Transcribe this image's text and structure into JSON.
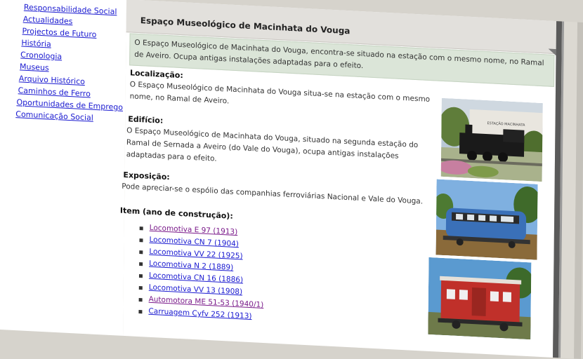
{
  "nav": {
    "items": [
      {
        "label": "Responsabilidade Social"
      },
      {
        "label": "Actualidades"
      },
      {
        "label": "Projectos de Futuro"
      },
      {
        "label": "História"
      },
      {
        "label": "Cronologia"
      },
      {
        "label": "Museus"
      },
      {
        "label": "Arquivo Histórico"
      },
      {
        "label": "Caminhos de Ferro"
      },
      {
        "label": "Oportunidades de Emprego"
      },
      {
        "label": "Comunicação Social"
      }
    ]
  },
  "page": {
    "title": "Espaço Museológico de Macinhata do Vouga",
    "intro": "O Espaço Museológico de Macinhata do Vouga, encontra-se situado na estação com o mesmo nome, no Ramal de Aveiro. Ocupa antigas instalações adaptadas para o efeito."
  },
  "sections": {
    "localizacao": {
      "heading": "Localização:",
      "text": "O Espaço Museológico de Macinhata do Vouga situa-se na estação com o mesmo nome, no Ramal de Aveiro."
    },
    "edificio": {
      "heading": "Edifício:",
      "text": "O Espaço Museológico de Macinhata do Vouga, situado na segunda estação do Ramal de Sernada a Aveiro (do Vale do Vouga), ocupa antigas instalações adaptadas para o efeito."
    },
    "exposicao": {
      "heading": "Exposição:",
      "text": "Pode apreciar-se o espólio das companhias ferroviárias Nacional e Vale do Vouga."
    },
    "item": {
      "heading": "Item (ano de construção):"
    }
  },
  "items": [
    {
      "label": "Locomotiva E 97 (1913)",
      "visited": true
    },
    {
      "label": "Locomotiva CN 7 (1904)",
      "visited": false
    },
    {
      "label": "Locomotiva VV 22 (1925)",
      "visited": false
    },
    {
      "label": "Locomotiva N 2 (1889)",
      "visited": false
    },
    {
      "label": "Locomotiva CN 16 (1886)",
      "visited": false
    },
    {
      "label": "Locomotiva VV 13 (1908)",
      "visited": false
    },
    {
      "label": "Automotora ME 51-53 (1940/1)",
      "visited": true
    },
    {
      "label": "Carruagem Cyfv 252 (1913)",
      "visited": false
    }
  ],
  "photos": [
    {
      "name": "black-steam-locomotive-photo",
      "sign": "ESTAÇÃO MACINHATA"
    },
    {
      "name": "blue-railcar-photo"
    },
    {
      "name": "red-carriage-photo"
    }
  ]
}
